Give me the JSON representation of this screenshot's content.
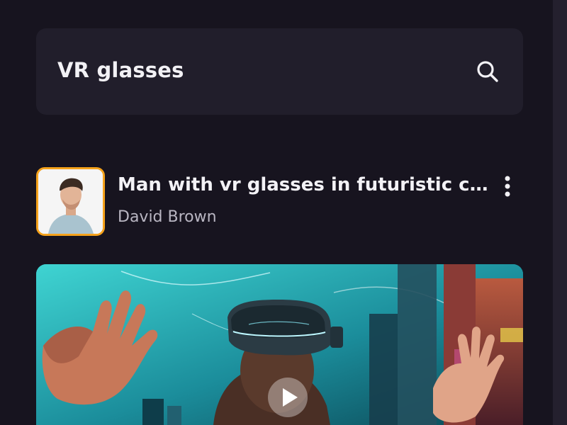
{
  "search": {
    "value": "VR glasses",
    "icon": "search-icon"
  },
  "result": {
    "title": "Man with vr glasses in futuristic ci...",
    "author": "David Brown",
    "avatar_border_color": "#f5a21b",
    "more_icon": "more-vertical-icon"
  },
  "video": {
    "thumbnail": "vr-city-thumbnail",
    "play_icon": "play-icon"
  },
  "colors": {
    "background": "#17141f",
    "search_bg": "#211e2b",
    "accent": "#f5a21b",
    "text_primary": "#f3f2f6",
    "text_secondary": "#b9b6c2"
  }
}
